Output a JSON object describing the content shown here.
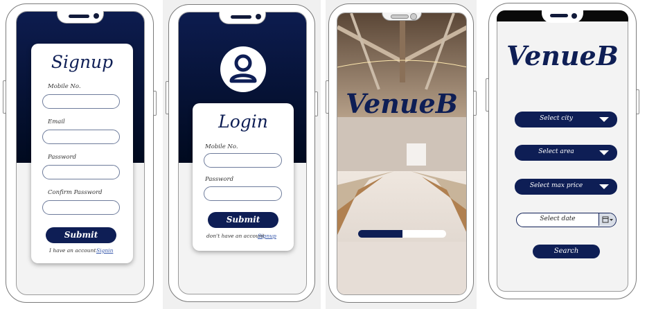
{
  "colors": {
    "navy": "#0e1e55",
    "accent_link": "#3355aa",
    "screen_bg": "#f3f3f3"
  },
  "signup": {
    "title": "Signup",
    "fields": [
      {
        "label": "Mobile No."
      },
      {
        "label": "Email"
      },
      {
        "label": "Password"
      },
      {
        "label": "Confirm Password"
      }
    ],
    "submit_label": "Submit",
    "footer_text": "I have an account",
    "footer_link": "Signin"
  },
  "login": {
    "avatar_icon": "user-avatar-icon",
    "title": "Login",
    "fields": [
      {
        "label": "Mobile No."
      },
      {
        "label": "Password"
      }
    ],
    "submit_label": "Submit",
    "footer_text": "don't have an account",
    "footer_link": "Signup"
  },
  "splash": {
    "brand": "VenueB",
    "progress": 0.5
  },
  "search": {
    "brand": "VenueB",
    "selects": [
      {
        "label": "Select city",
        "icon": "caret-down-icon"
      },
      {
        "label": "Select area",
        "icon": "caret-down-icon"
      },
      {
        "label": "Select max price",
        "icon": "caret-down-icon"
      }
    ],
    "date_label": "Select date",
    "date_icon": "calendar-icon",
    "search_label": "Search"
  }
}
